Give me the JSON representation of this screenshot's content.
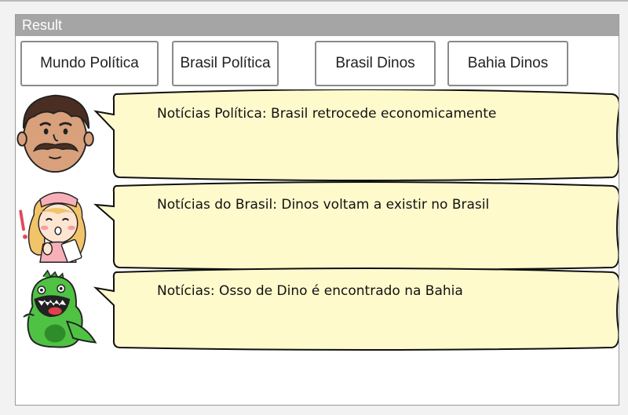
{
  "panel": {
    "title": "Result"
  },
  "buttons": [
    {
      "label": "Mundo Política"
    },
    {
      "label": "Brasil Política"
    },
    {
      "label": "Brasil Dinos"
    },
    {
      "label": "Bahia Dinos"
    }
  ],
  "news": [
    {
      "avatar": "mustache-man-icon",
      "text": "Notícias Política: Brasil retrocede economicamente"
    },
    {
      "avatar": "nurse-girl-icon",
      "text": "Notícias do Brasil: Dinos voltam a existir no Brasil"
    },
    {
      "avatar": "green-dino-icon",
      "text": "Notícias: Osso de Dino é encontrado na Bahia"
    }
  ],
  "colors": {
    "bubble_fill": "#fffacc",
    "header_bg": "#a5a5a5"
  }
}
